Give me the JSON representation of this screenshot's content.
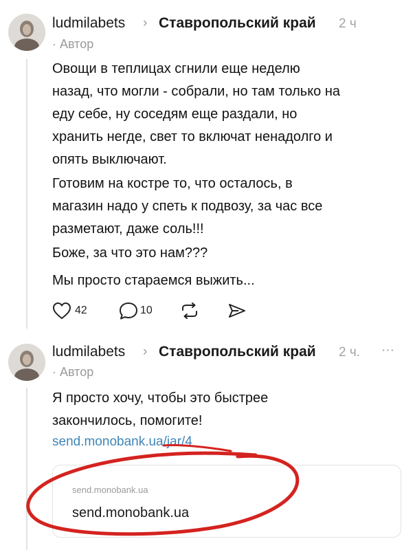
{
  "posts": [
    {
      "username": "ludmilabets",
      "chevron": "›",
      "region": "Ставропольский край",
      "time": "2 ч",
      "author_label": "· Автор",
      "lines": [
        "Овощи в теплицах сгнили еще неделю",
        "назад, что могли - собрали, но там только на",
        "еду себе, ну соседям еще раздали, но",
        "хранить негде, свет то включат ненадолго и",
        "опять выключают.",
        "Готовим на костре то, что осталось, в",
        "магазин надо у спеть к подвозу, за час все",
        "разметают, даже соль!!!",
        "Боже, за что это нам???",
        "Мы просто стараемся выжить..."
      ],
      "likes": "42",
      "replies": "10"
    },
    {
      "username": "ludmilabets",
      "chevron": "›",
      "region": "Ставропольский край",
      "time": "2 ч.",
      "more": "···",
      "author_label": "· Автор",
      "lines": [
        "Я просто хочу, чтобы это быстрее",
        "закончилось, помогите!"
      ],
      "link": "send.monobank.ua/jar/4",
      "card_domain": "send.monobank.ua",
      "card_title": "send.monobank.ua"
    }
  ],
  "icons": {
    "heart": "heart-icon",
    "reply": "reply-icon",
    "repost": "repost-icon",
    "share": "send-icon",
    "more": "more-icon"
  },
  "colors": {
    "link": "#3f85b7",
    "highlight_circle": "#d4231f",
    "muted": "#9a9a9a"
  }
}
